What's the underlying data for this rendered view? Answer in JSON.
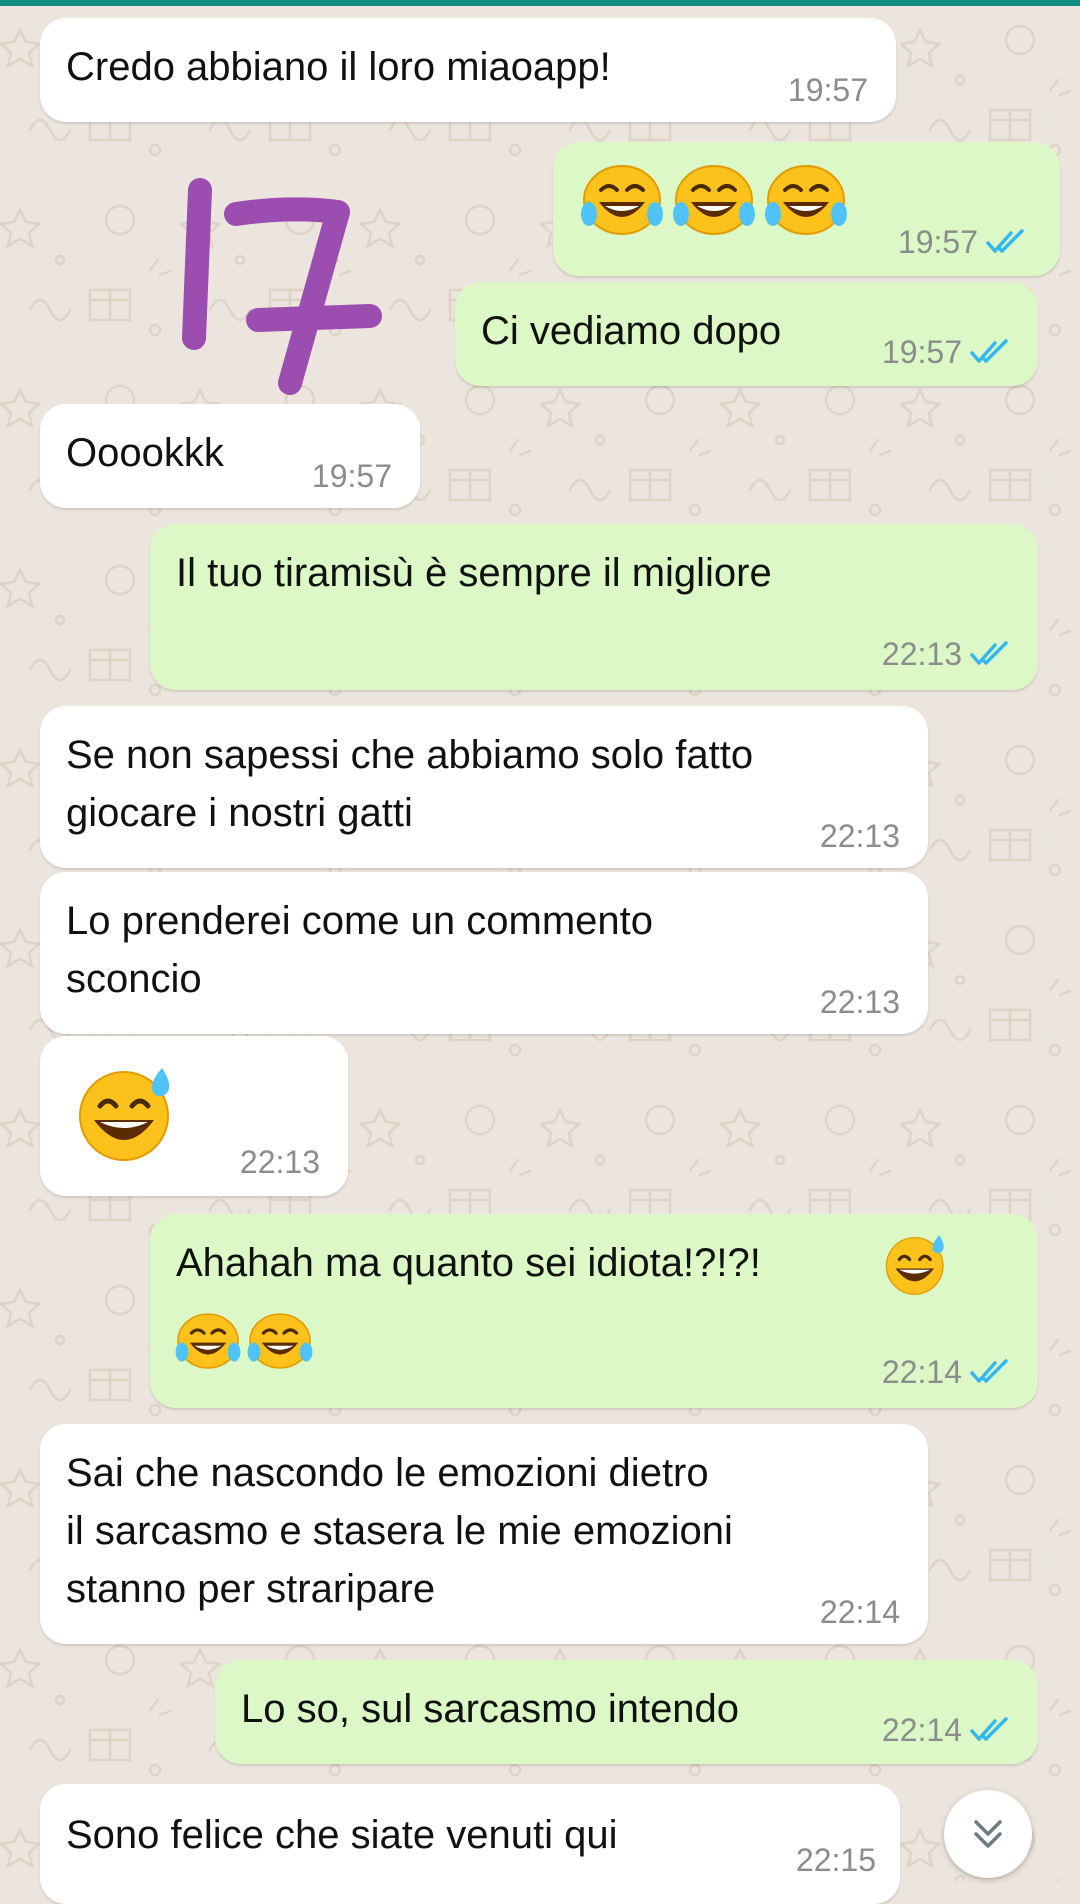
{
  "messages": [
    {
      "id": "m1",
      "dir": "in",
      "text": "Credo abbiano il loro miaoapp!",
      "time": "19:57"
    },
    {
      "id": "m2",
      "dir": "out",
      "emoji": [
        "tears-of-joy",
        "tears-of-joy",
        "tears-of-joy"
      ],
      "time": "19:57",
      "status": "read"
    },
    {
      "id": "m3",
      "dir": "out",
      "text": "Ci vediamo dopo",
      "time": "19:57",
      "status": "read"
    },
    {
      "id": "m4",
      "dir": "in",
      "text": "Ooookkk",
      "time": "19:57"
    },
    {
      "id": "m5",
      "dir": "out",
      "text": "Il tuo tiramisù è sempre il migliore",
      "time": "22:13",
      "status": "read"
    },
    {
      "id": "m6",
      "dir": "in",
      "text": "Se non sapessi che abbiamo solo fatto\ngiocare i nostri gatti",
      "time": "22:13"
    },
    {
      "id": "m7",
      "dir": "in",
      "text": "Lo prenderei come un commento\nsconcio",
      "time": "22:13"
    },
    {
      "id": "m8",
      "dir": "in",
      "emoji": [
        "grinning-sweat"
      ],
      "time": "22:13"
    },
    {
      "id": "m9",
      "dir": "out",
      "text": "Ahahah ma quanto sei idiota!?!?!",
      "emoji": [
        "grinning-sweat",
        "tears-of-joy",
        "tears-of-joy"
      ],
      "time": "22:14",
      "status": "read"
    },
    {
      "id": "m10",
      "dir": "in",
      "text": "Sai che nascondo le emozioni dietro\nil sarcasmo e stasera le mie emozioni\nstanno per straripare",
      "time": "22:14"
    },
    {
      "id": "m11",
      "dir": "out",
      "text": "Lo so, sul sarcasmo intendo",
      "time": "22:14",
      "status": "read"
    },
    {
      "id": "m12",
      "dir": "in",
      "text": "Sono felice che siate venuti qui",
      "time": "22:15"
    }
  ],
  "overlay_number": "17",
  "scroll_button_icon": "double-chevron-down-icon",
  "colors": {
    "background": "#ECE5DD",
    "incoming_bubble": "#FFFFFF",
    "outgoing_bubble": "#DCF8C6",
    "read_ticks": "#34B7F1",
    "timestamp": "#8C8C8C",
    "overlay_number": "#9B4DB0",
    "top_bar": "#128C7E"
  }
}
